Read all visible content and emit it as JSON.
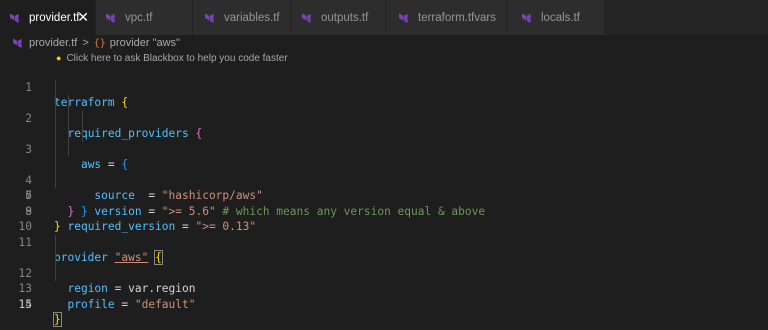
{
  "tabs": [
    {
      "label": "provider.tf",
      "active": true,
      "close": "✕"
    },
    {
      "label": "vpc.tf"
    },
    {
      "label": "variables.tf"
    },
    {
      "label": "outputs.tf"
    },
    {
      "label": "terraform.tfvars"
    },
    {
      "label": "locals.tf"
    }
  ],
  "breadcrumb": {
    "file": "provider.tf",
    "separator": ">",
    "symbol_icon": "{}",
    "symbol": "provider \"aws\""
  },
  "codelens": {
    "icon": "lightbulb-icon",
    "text": "Click here to ask Blackbox to help you code faster"
  },
  "colors": {
    "terraform_icon": "#7b42bc",
    "keyword": "#4fc1ff",
    "string": "#ce9178",
    "comment": "#6a9955",
    "bracket_level1": "#ffd700",
    "bracket_level2": "#da70d6",
    "bracket_level3": "#179fff"
  },
  "code": {
    "l1": {
      "num": "1",
      "kw": "terraform",
      "b": "{"
    },
    "l2": {
      "num": "2",
      "kw": "required_providers",
      "b": "{"
    },
    "l3": {
      "num": "3",
      "kw": "aws",
      "op": " = ",
      "b": "{"
    },
    "l4": {
      "num": "4",
      "kw": "source",
      "op": "  = ",
      "str": "\"hashicorp/aws\""
    },
    "l5": {
      "num": "5",
      "kw": "version",
      "op": " = ",
      "str": "\">= 5.6\"",
      "comment": " # which means any version equal & above"
    },
    "l6": {
      "num": "6",
      "b": "}"
    },
    "l7": {
      "num": "7",
      "b": "}"
    },
    "l8": {
      "num": "8",
      "kw": "required_version",
      "op": " = ",
      "str": "\">= 0.13\""
    },
    "l9": {
      "num": "9",
      "b": "}"
    },
    "l10": {
      "num": "10"
    },
    "l11": {
      "num": "11",
      "kw": "provider",
      "str": "\"aws\"",
      "b": "{"
    },
    "l12": {
      "num": "12",
      "kw": "region",
      "op": " = ",
      "val": "var.region"
    },
    "l13": {
      "num": "13",
      "kw": "profile",
      "op": " = ",
      "str": "\"default\""
    },
    "l14": {
      "num": "14"
    },
    "l15": {
      "num": "15",
      "b": "}"
    }
  }
}
